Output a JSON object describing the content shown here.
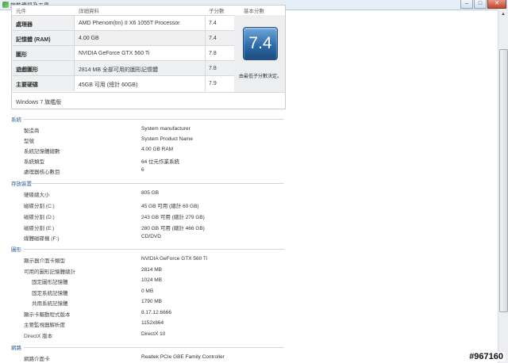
{
  "window": {
    "title": "效能資訊及工具",
    "buttons": {
      "minimize": "–",
      "maximize": "□",
      "close": "✕"
    }
  },
  "wei": {
    "headers": {
      "component": "元件",
      "details": "詳細資料",
      "subscore": "子分數",
      "basescore": "基本分數"
    },
    "rows": [
      {
        "label": "處理器",
        "desc": "AMD Phenom(tm) II X6 1055T Processor",
        "score": "7.4"
      },
      {
        "label": "記憶體 (RAM)",
        "desc": "4.00 GB",
        "score": "7.4"
      },
      {
        "label": "圖形",
        "desc": "NVIDIA GeForce GTX 560 Ti",
        "score": "7.8"
      },
      {
        "label": "遊戲圖形",
        "desc": "2814 MB 全部可用的圖形記憶體",
        "score": "7.8"
      },
      {
        "label": "主要硬碟",
        "desc": "45GB 可用 (總計 60GB)",
        "score": "7.9"
      }
    ],
    "base_score": "7.4",
    "base_note": "由最低子分數決定。",
    "edition": "Windows 7 旗艦版"
  },
  "sections": {
    "system": {
      "title": "系統",
      "rows": [
        {
          "k": "製造商",
          "v": "System manufacturer"
        },
        {
          "k": "型號",
          "v": "System Product Name"
        },
        {
          "k": "系統記憶體總數",
          "v": "4.00 GB RAM"
        },
        {
          "k": "系統類型",
          "v": "64 位元作業系統"
        },
        {
          "k": "處理器核心數目",
          "v": "6"
        }
      ]
    },
    "storage": {
      "title": "存放裝置",
      "rows": [
        {
          "k": "硬碟總大小",
          "v": "805 GB"
        },
        {
          "k": "磁碟分割 (C:)",
          "v": "45 GB 可用 (總計 60 GB)"
        },
        {
          "k": "磁碟分割 (D:)",
          "v": "243 GB 可用 (總計 279 GB)"
        },
        {
          "k": "磁碟分割 (E:)",
          "v": "280 GB 可用 (總計 466 GB)"
        },
        {
          "k": "媒體磁碟機 (F:)",
          "v": "CD/DVD"
        }
      ]
    },
    "graphics": {
      "title": "圖形",
      "rows": [
        {
          "k": "顯示器介面卡類型",
          "v": "NVIDIA GeForce GTX 560 Ti"
        },
        {
          "k": "可用的圖形記憶體總計",
          "v": "2814 MB"
        },
        {
          "k": "固定圖形記憶體",
          "v": "1024 MB"
        },
        {
          "k": "固定系統記憶體",
          "v": "0 MB"
        },
        {
          "k": "共用系統記憶體",
          "v": "1790 MB"
        },
        {
          "k": "顯示卡驅動程式版本",
          "v": "8.17.12.6666"
        },
        {
          "k": "主要監視器解析度",
          "v": "1152x864"
        },
        {
          "k": "DirectX 版本",
          "v": "DirectX 10"
        }
      ]
    },
    "network": {
      "title": "網路",
      "rows": [
        {
          "k": "網路介面卡",
          "v": "Realtek PCIe GBE Family Controller"
        }
      ]
    }
  },
  "watermark": "#967160"
}
